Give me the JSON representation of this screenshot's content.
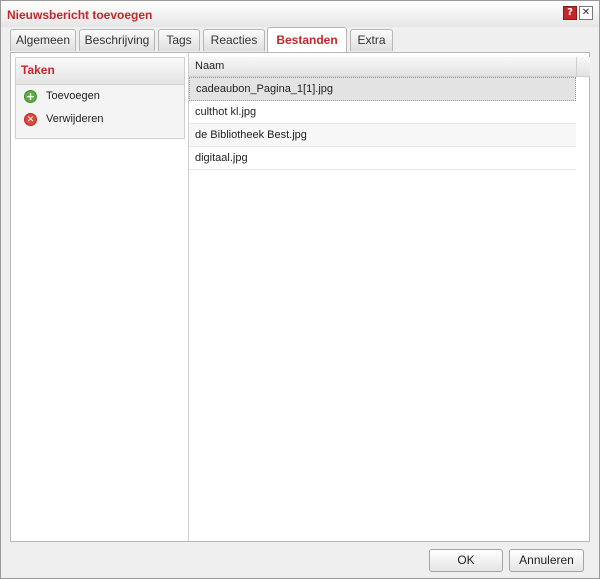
{
  "window": {
    "title": "Nieuwsbericht toevoegen",
    "help_label": "?",
    "close_label": "✕"
  },
  "tabs": [
    {
      "label": "Algemeen"
    },
    {
      "label": "Beschrijving"
    },
    {
      "label": "Tags"
    },
    {
      "label": "Reacties"
    },
    {
      "label": "Bestanden"
    },
    {
      "label": "Extra"
    }
  ],
  "tasks": {
    "header": "Taken",
    "items": [
      {
        "label": "Toevoegen",
        "icon": "add-icon",
        "glyph": "+"
      },
      {
        "label": "Verwijderen",
        "icon": "remove-icon",
        "glyph": "✕"
      }
    ]
  },
  "files": {
    "column": "Naam",
    "rows": [
      "cadeaubon_Pagina_1[1].jpg",
      "culthot kl.jpg",
      "de Bibliotheek Best.jpg",
      "digitaal.jpg"
    ]
  },
  "buttons": {
    "ok": "OK",
    "cancel": "Annuleren"
  },
  "colors": {
    "accent": "#c0282b"
  }
}
